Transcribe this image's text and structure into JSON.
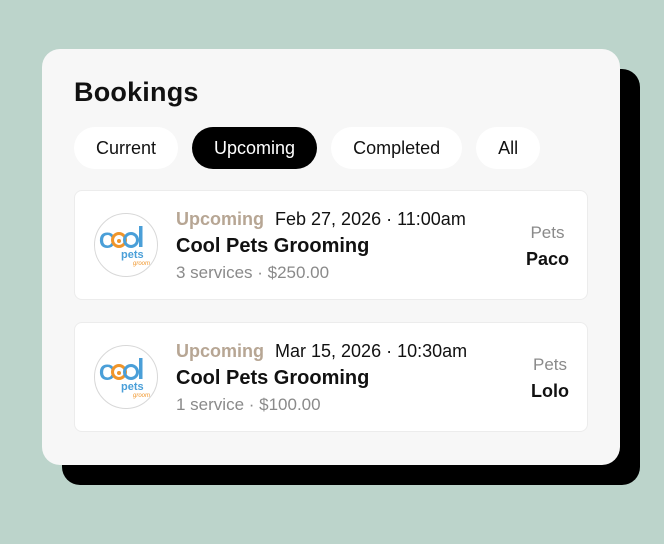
{
  "page": {
    "title": "Bookings"
  },
  "tabs": [
    {
      "label": "Current",
      "active": false
    },
    {
      "label": "Upcoming",
      "active": true
    },
    {
      "label": "Completed",
      "active": false
    },
    {
      "label": "All",
      "active": false
    }
  ],
  "logo": {
    "word1": "Cool",
    "word2": "pets",
    "word3": "groom",
    "icon": "cool-pets-logo"
  },
  "bookings": [
    {
      "status": "Upcoming",
      "datetime": "Feb 27, 2026 · 11:00am",
      "vendor": "Cool Pets Grooming",
      "details": "3 services · $250.00",
      "pets_label": "Pets",
      "pet_name": "Paco"
    },
    {
      "status": "Upcoming",
      "datetime": "Mar 15, 2026 · 10:30am",
      "vendor": "Cool Pets Grooming",
      "details": "1 service · $100.00",
      "pets_label": "Pets",
      "pet_name": "Lolo"
    }
  ],
  "colors": {
    "background": "#bcd4cb",
    "card": "#f7f7f7",
    "active_tab": "#000000",
    "status": "#b7a694",
    "logo_blue": "#4a9fd8",
    "logo_orange": "#f0952a"
  }
}
